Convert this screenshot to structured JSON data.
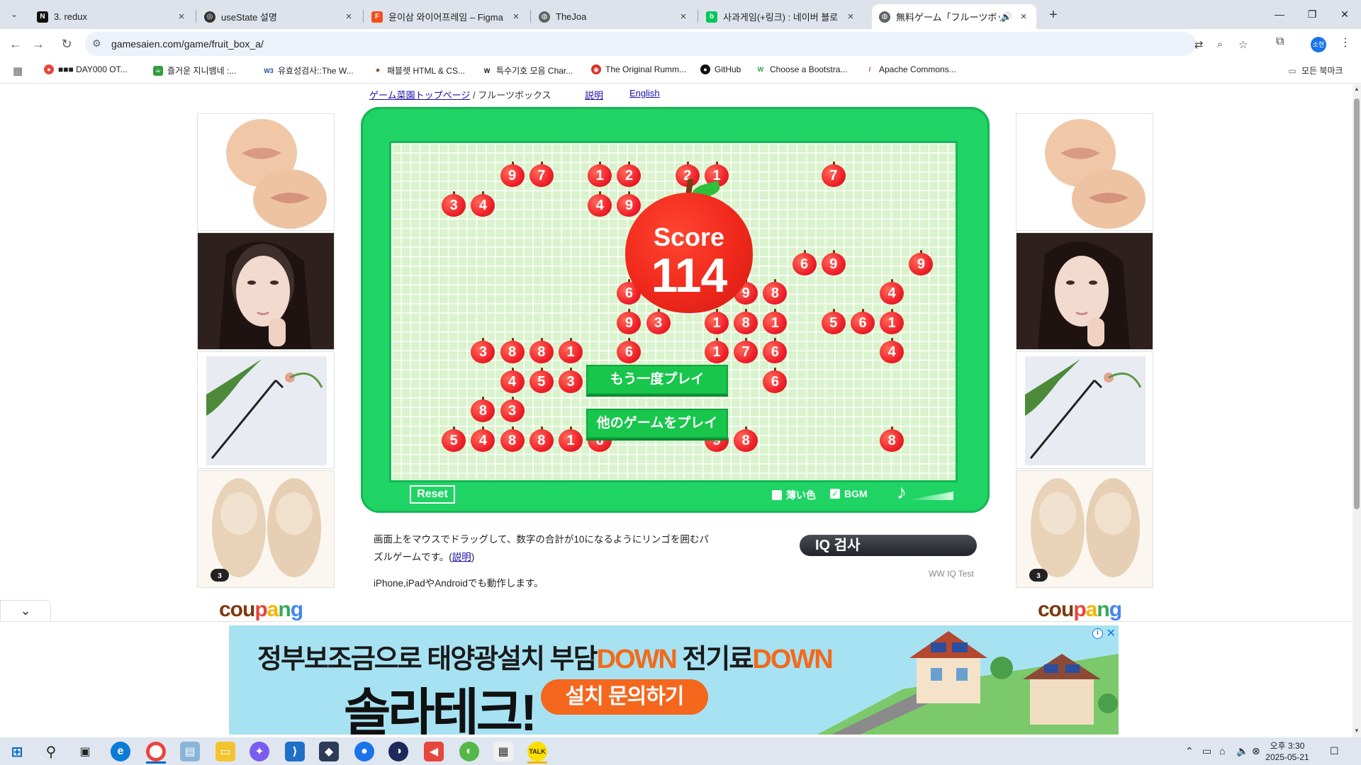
{
  "browser": {
    "tabs": [
      {
        "title": "3. redux",
        "favicon": "N",
        "color": "#111111"
      },
      {
        "title": "useState 설명",
        "favicon": "◎",
        "color": "#444444"
      },
      {
        "title": "윤이삼 와이어프레임 – Figma",
        "favicon": "F",
        "color": "#f24e1e"
      },
      {
        "title": "TheJoa",
        "favicon": "🌐",
        "color": "#5f6368"
      },
      {
        "title": "사과게임(+링크) : 네이버 블로",
        "favicon": "B",
        "color": "#03c75a"
      },
      {
        "title": "無料ゲーム「フルーツボックス」",
        "favicon": "🌐",
        "color": "#5f6368"
      }
    ],
    "url": "gamesaien.com/game/fruit_box_a/",
    "bookmarks": [
      {
        "label": "■■■ DAY000 OT...",
        "color": "#e8453c",
        "icon": "●"
      },
      {
        "label": "즐거운 지니뱀네 :...",
        "color": "#2e9e3e",
        "icon": "☕"
      },
      {
        "label": "유효성검사::The W...",
        "color": "#1a4fa0",
        "icon": "W3"
      },
      {
        "label": "패블렛 HTML & CS...",
        "color": "#6b3a10",
        "icon": "★"
      },
      {
        "label": "특수기호 모음 Char...",
        "color": "#111111",
        "icon": "W"
      },
      {
        "label": "The Original Rumm...",
        "color": "#d93025",
        "icon": "◉"
      },
      {
        "label": "GitHub",
        "color": "#111111",
        "icon": "●"
      },
      {
        "label": "Choose a Bootstra...",
        "color": "#2e9e3e",
        "icon": "W"
      },
      {
        "label": "Apache Commons...",
        "color": "#c2185b",
        "icon": "/"
      }
    ],
    "all_bookmarks": "모든 북마크",
    "profile": "소현"
  },
  "page": {
    "breadcrumb_link": "ゲーム菜園トップページ",
    "breadcrumb_sep": " / ",
    "breadcrumb_current": "フルーツボックス",
    "help_link": "説明",
    "english_link": "English",
    "description_1": "画面上をマウスでドラッグして、数字の合計が10になるようにリンゴを囲むパズルゲームです。(",
    "description_link": "説明",
    "description_2": ")",
    "description_3": "iPhone,iPadやAndroidでも動作します。",
    "iq_button": "IQ 검사",
    "iq_source": "WW IQ Test",
    "coupang": "coupang"
  },
  "game": {
    "score_label": "Score",
    "score_value": "114",
    "play_again": "もう一度プレイ",
    "other_games": "他のゲームをプレイ",
    "reset": "Reset",
    "light_color_label": "薄い色",
    "light_color_checked": false,
    "bgm_label": "BGM",
    "bgm_checked": true,
    "apples": [
      {
        "n": "9",
        "r": 0,
        "c": 3
      },
      {
        "n": "7",
        "r": 0,
        "c": 4
      },
      {
        "n": "1",
        "r": 0,
        "c": 6
      },
      {
        "n": "2",
        "r": 0,
        "c": 7
      },
      {
        "n": "2",
        "r": 0,
        "c": 9
      },
      {
        "n": "1",
        "r": 0,
        "c": 10
      },
      {
        "n": "7",
        "r": 0,
        "c": 14
      },
      {
        "n": "3",
        "r": 1,
        "c": 1
      },
      {
        "n": "4",
        "r": 1,
        "c": 2
      },
      {
        "n": "4",
        "r": 1,
        "c": 6
      },
      {
        "n": "9",
        "r": 1,
        "c": 7
      },
      {
        "n": "6",
        "r": 3,
        "c": 13
      },
      {
        "n": "9",
        "r": 3,
        "c": 14
      },
      {
        "n": "9",
        "r": 3,
        "c": 17
      },
      {
        "n": "6",
        "r": 4,
        "c": 7
      },
      {
        "n": "9",
        "r": 4,
        "c": 11
      },
      {
        "n": "8",
        "r": 4,
        "c": 12
      },
      {
        "n": "4",
        "r": 4,
        "c": 16
      },
      {
        "n": "9",
        "r": 5,
        "c": 7
      },
      {
        "n": "3",
        "r": 5,
        "c": 8
      },
      {
        "n": "1",
        "r": 5,
        "c": 10
      },
      {
        "n": "8",
        "r": 5,
        "c": 11
      },
      {
        "n": "1",
        "r": 5,
        "c": 12
      },
      {
        "n": "5",
        "r": 5,
        "c": 14
      },
      {
        "n": "6",
        "r": 5,
        "c": 15
      },
      {
        "n": "1",
        "r": 5,
        "c": 16
      },
      {
        "n": "3",
        "r": 6,
        "c": 2
      },
      {
        "n": "8",
        "r": 6,
        "c": 3
      },
      {
        "n": "8",
        "r": 6,
        "c": 4
      },
      {
        "n": "1",
        "r": 6,
        "c": 5
      },
      {
        "n": "6",
        "r": 6,
        "c": 7
      },
      {
        "n": "1",
        "r": 6,
        "c": 10
      },
      {
        "n": "7",
        "r": 6,
        "c": 11
      },
      {
        "n": "6",
        "r": 6,
        "c": 12
      },
      {
        "n": "4",
        "r": 6,
        "c": 16
      },
      {
        "n": "4",
        "r": 7,
        "c": 3
      },
      {
        "n": "5",
        "r": 7,
        "c": 4
      },
      {
        "n": "3",
        "r": 7,
        "c": 5
      },
      {
        "n": "6",
        "r": 7,
        "c": 12
      },
      {
        "n": "8",
        "r": 8,
        "c": 2
      },
      {
        "n": "3",
        "r": 8,
        "c": 3
      },
      {
        "n": "5",
        "r": 9,
        "c": 1
      },
      {
        "n": "4",
        "r": 9,
        "c": 2
      },
      {
        "n": "8",
        "r": 9,
        "c": 3
      },
      {
        "n": "8",
        "r": 9,
        "c": 4
      },
      {
        "n": "1",
        "r": 9,
        "c": 5
      },
      {
        "n": "6",
        "r": 9,
        "c": 6
      },
      {
        "n": "9",
        "r": 9,
        "c": 10
      },
      {
        "n": "8",
        "r": 9,
        "c": 11
      },
      {
        "n": "8",
        "r": 9,
        "c": 16
      }
    ]
  },
  "banner": {
    "headline_a": "정부보조금으로 태양광설치 ",
    "headline_b": "부담",
    "headline_c": "DOWN",
    "headline_d": " 전기료",
    "headline_e": "DOWN",
    "brand": "솔라테크!",
    "cta": "설치 문의하기"
  },
  "taskbar": {
    "time": "오후 3:30",
    "date": "2025-05-21"
  }
}
